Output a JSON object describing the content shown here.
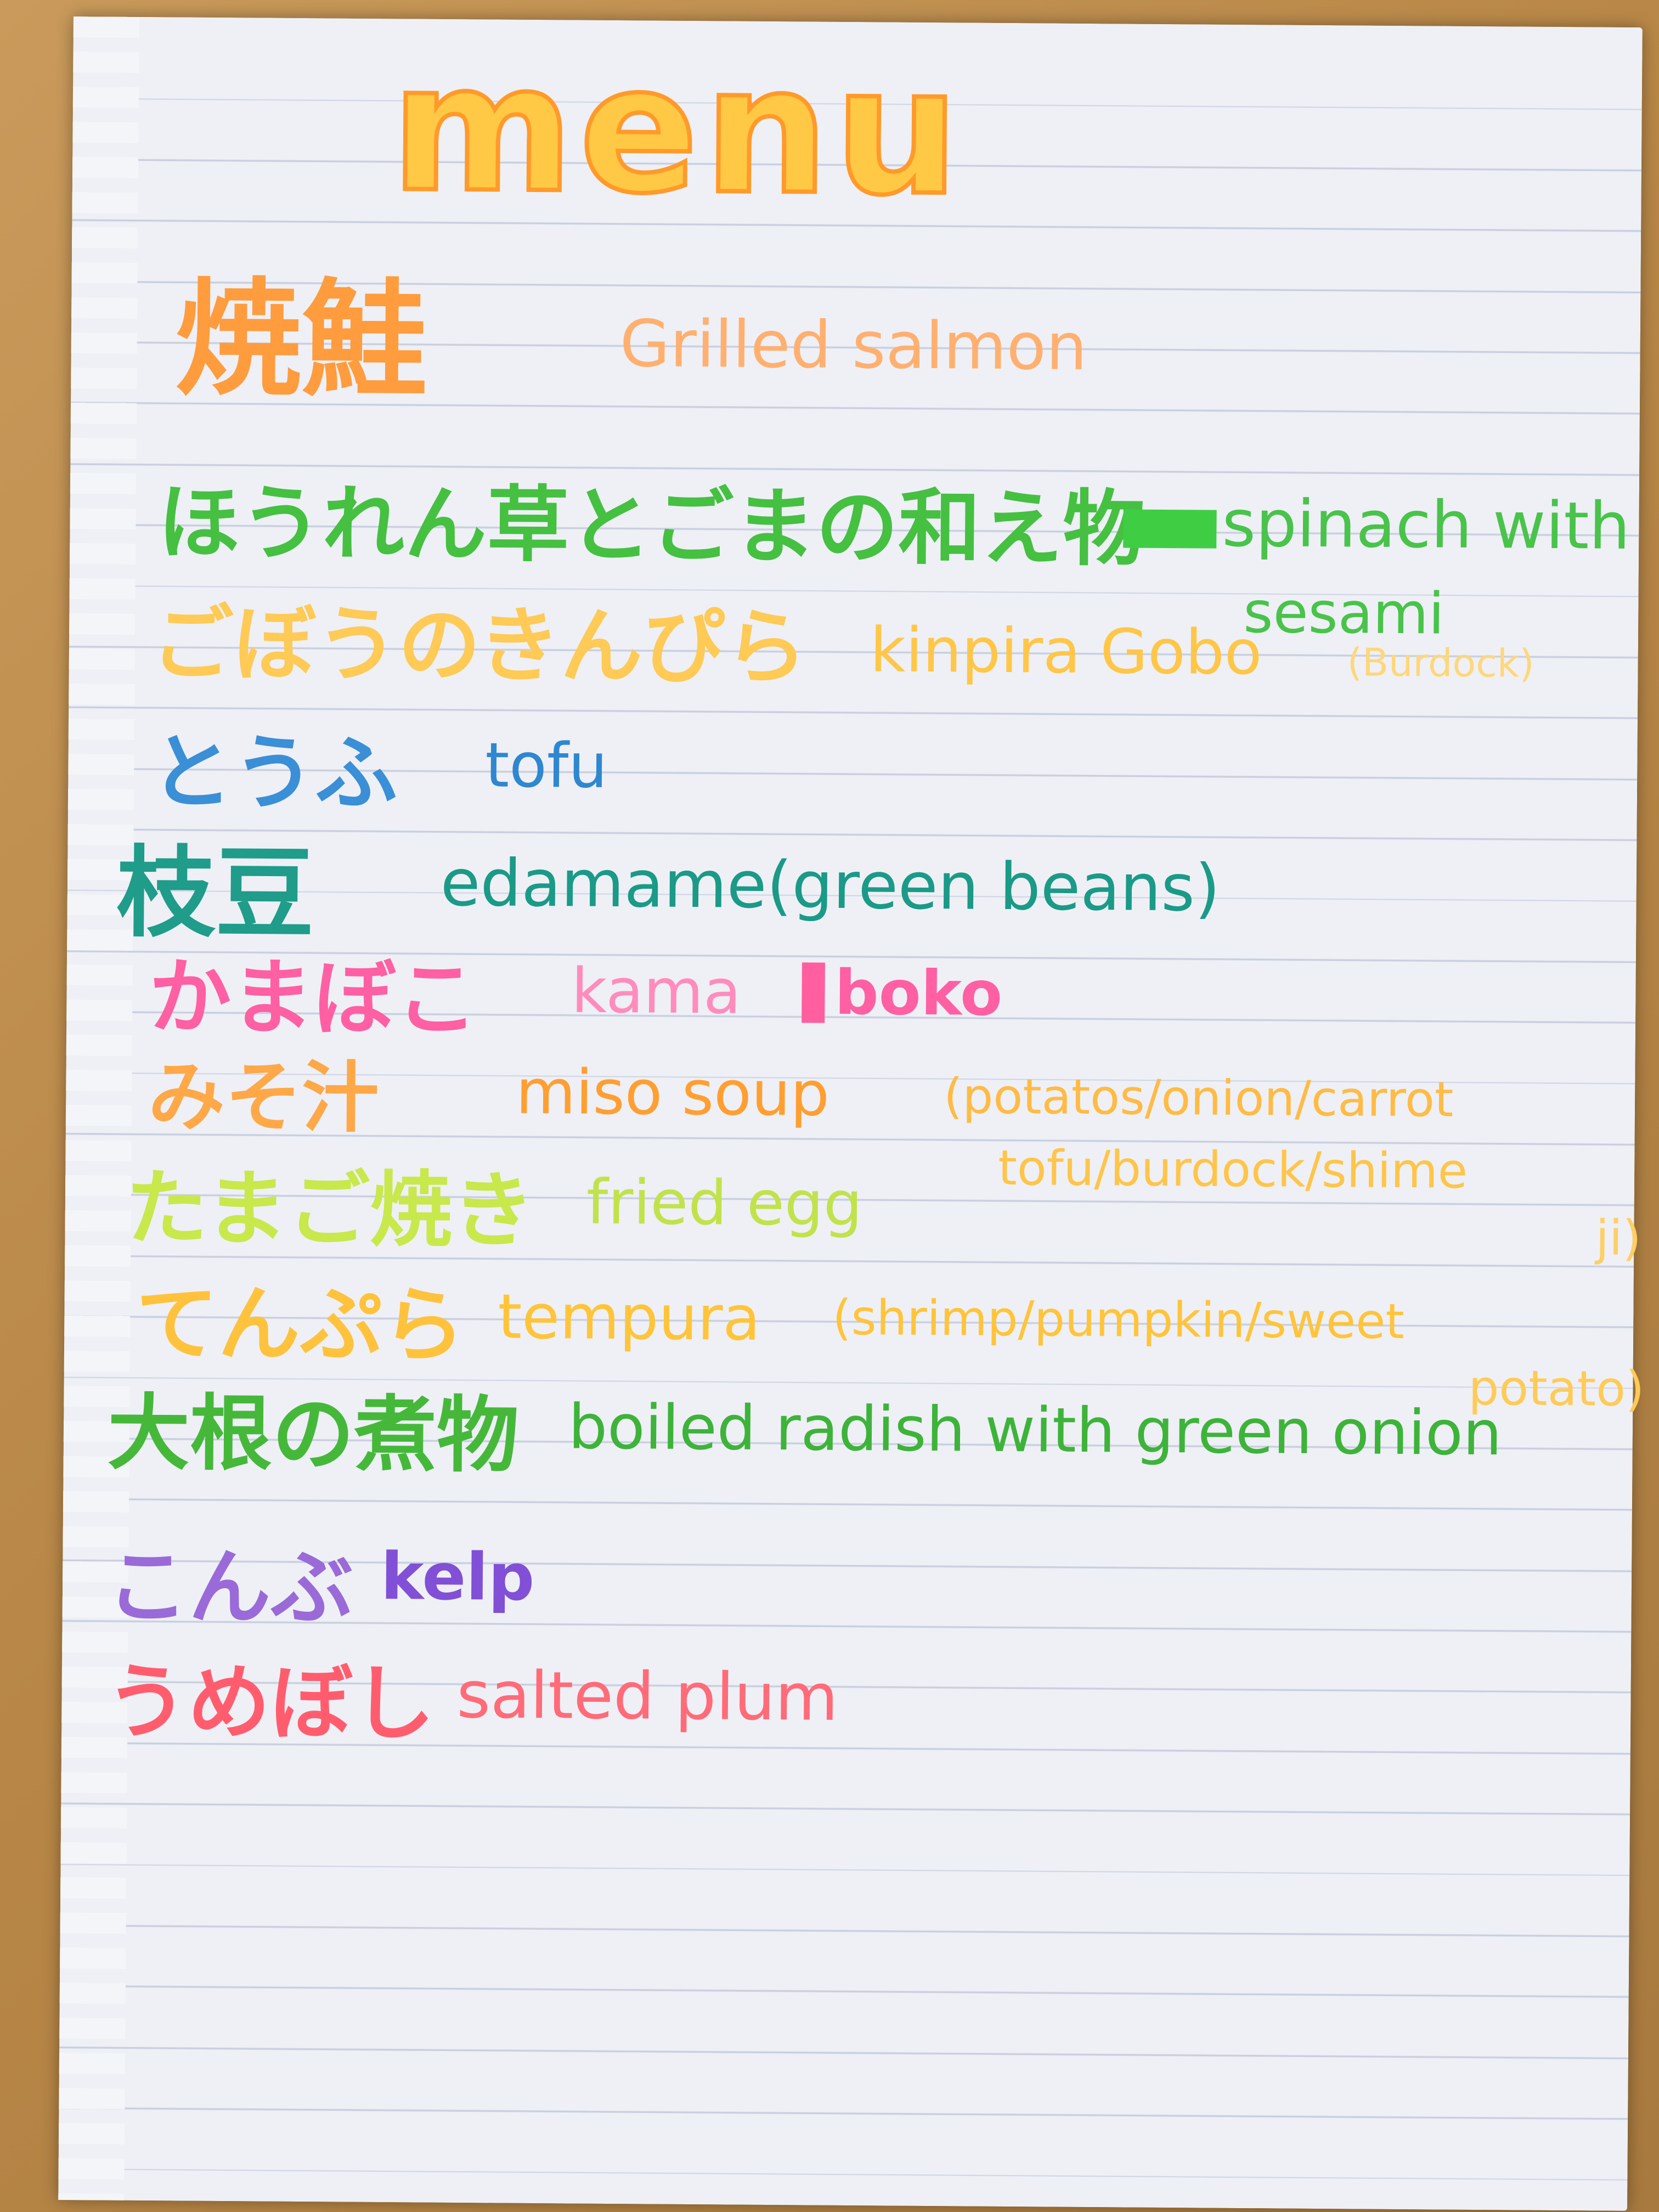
{
  "title": "menu",
  "items": [
    {
      "jp": "焼鮭",
      "en": "Grilled salmon",
      "color": "#ffa451"
    },
    {
      "jp": "ほうれん草とごまの和え物",
      "en": "spinach with",
      "en2": "sesami",
      "color": "#4cc84a"
    },
    {
      "jp": "ごぼうのきんぴら",
      "en": "kinpira Gobo",
      "en2": "(Burdock)",
      "color": "#ffc648"
    },
    {
      "jp": "とうふ",
      "en": "tofu",
      "color": "#3a8fd6"
    },
    {
      "jp": "枝豆",
      "en": "edamame(green beans)",
      "color": "#1f9c8a"
    },
    {
      "jp": "かまぼこ",
      "en": "kama",
      "en_b": "boko",
      "color": "#ff6aa7"
    },
    {
      "jp": "みそ汁",
      "en": "miso soup",
      "en2": "(potatos/onion/carrot",
      "en3": "tofu/burdock/shime",
      "en4": "ji)",
      "color": "#ffa43a"
    },
    {
      "jp": "たまご焼き",
      "en": "fried egg",
      "color": "#c6e94a"
    },
    {
      "jp": "てんぷら",
      "en": "tempura",
      "en2": "(shrimp/pumpkin/sweet",
      "en3": "potato)",
      "color": "#ffc43a"
    },
    {
      "jp": "大根の煮物",
      "en": "boiled radish with green onion",
      "color": "#4cbd3c"
    },
    {
      "jp": "こんぶ",
      "en": "kelp",
      "color": "#8a55d6"
    },
    {
      "jp": "うめぼし",
      "en": "salted plum",
      "color": "#ff6b78"
    }
  ]
}
